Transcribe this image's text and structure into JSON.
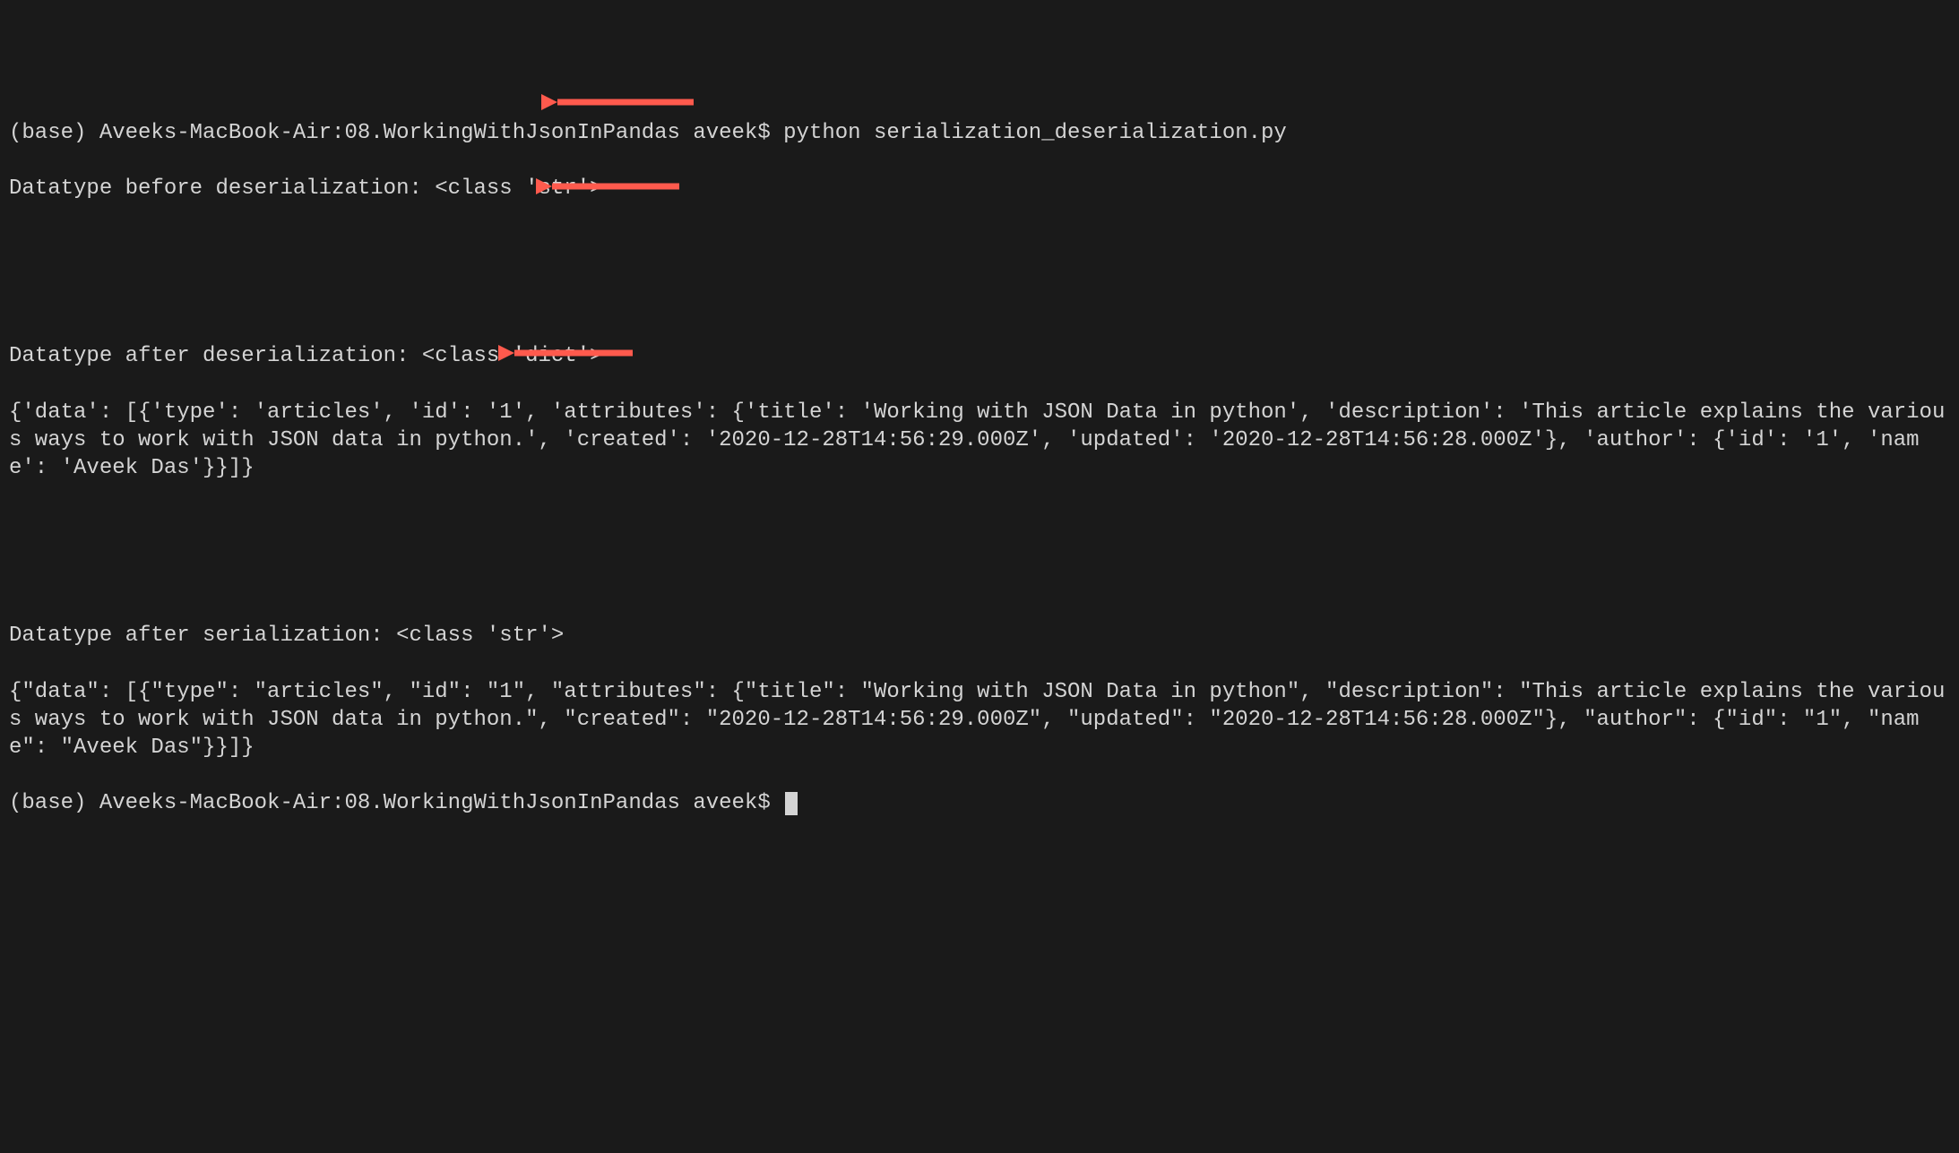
{
  "terminal": {
    "line1_prompt": "(base) Aveeks-MacBook-Air:08.WorkingWithJsonInPandas aveek$ ",
    "line1_command": "python serialization_deserialization.py",
    "line2": "Datatype before deserialization: <class 'str'>",
    "blank1": "",
    "blank2": "",
    "line3": "Datatype after deserialization: <class 'dict'>",
    "line4": "{'data': [{'type': 'articles', 'id': '1', 'attributes': {'title': 'Working with JSON Data in python', 'description': 'This article explains the various ways to work with JSON data in python.', 'created': '2020-12-28T14:56:29.000Z', 'updated': '2020-12-28T14:56:28.000Z'}, 'author': {'id': '1', 'name': 'Aveek Das'}}]}",
    "blank3": "",
    "blank4": "",
    "line5": "Datatype after serialization: <class 'str'>",
    "line6": "{\"data\": [{\"type\": \"articles\", \"id\": \"1\", \"attributes\": {\"title\": \"Working with JSON Data in python\", \"description\": \"This article explains the various ways to work with JSON data in python.\", \"created\": \"2020-12-28T14:56:29.000Z\", \"updated\": \"2020-12-28T14:56:28.000Z\"}, \"author\": {\"id\": \"1\", \"name\": \"Aveek Das\"}}]}",
    "line7_prompt": "(base) Aveeks-MacBook-Air:08.WorkingWithJsonInPandas aveek$ "
  },
  "annotations": {
    "arrow_color": "#ff5a4d"
  }
}
